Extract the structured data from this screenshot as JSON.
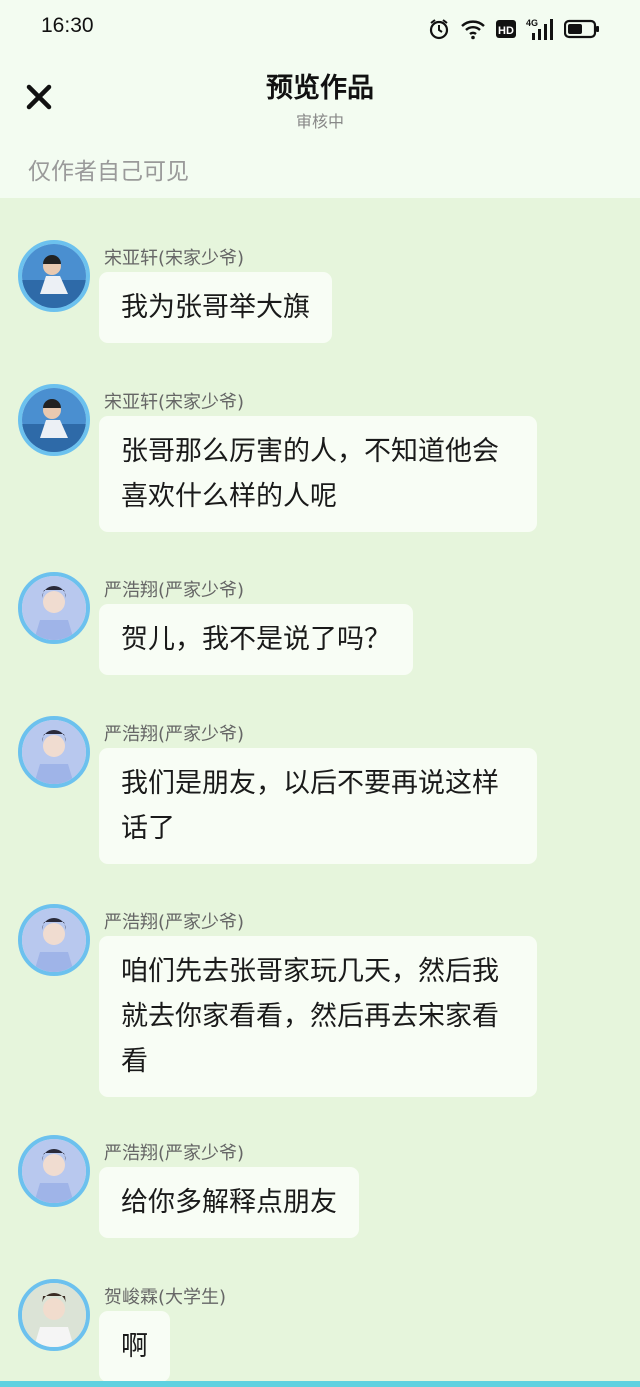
{
  "status_bar": {
    "time": "16:30",
    "icons": [
      "alarm-icon",
      "wifi-icon",
      "hd-icon",
      "4g-signal-icon",
      "battery-icon"
    ],
    "hd_label": "HD",
    "network_label": "4G"
  },
  "header": {
    "title": "预览作品",
    "subtitle": "审核中",
    "visibility_note": "仅作者自己可见"
  },
  "messages": [
    {
      "name": "宋亚轩(宋家少爷)",
      "text": "我为张哥举大旗"
    },
    {
      "name": "宋亚轩(宋家少爷)",
      "text": "张哥那么厉害的人，不知道他会喜欢什么样的人呢"
    },
    {
      "name": "严浩翔(严家少爷)",
      "text": "贺儿，我不是说了吗？"
    },
    {
      "name": "严浩翔(严家少爷)",
      "text": "我们是朋友，以后不要再说这样话了"
    },
    {
      "name": "严浩翔(严家少爷)",
      "text": "咱们先去张哥家玩几天，然后我就去你家看看，然后再去宋家看看"
    },
    {
      "name": "严浩翔(严家少爷)",
      "text": "给你多解释点朋友"
    },
    {
      "name": "贺峻霖(大学生)",
      "text": "啊"
    }
  ],
  "colors": {
    "page_bg": "#e6f5dc",
    "header_bg": "#f3fcf1",
    "bubble_bg": "#f8fdf5",
    "avatar_ring": "#6cc1ee"
  }
}
